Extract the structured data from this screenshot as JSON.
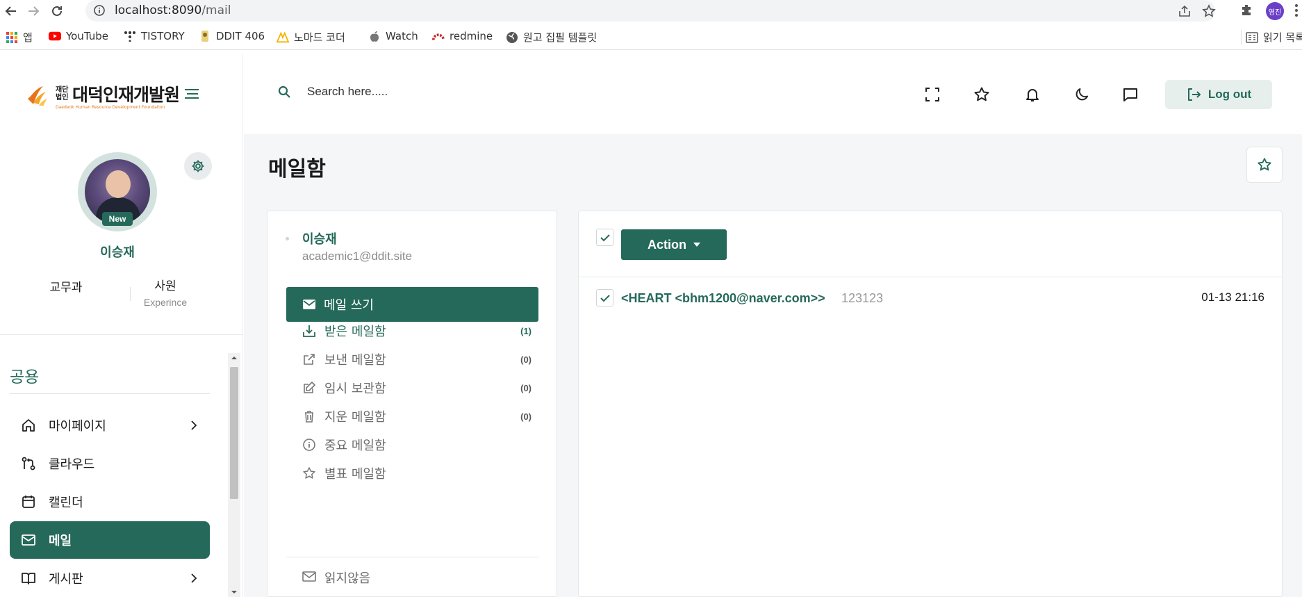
{
  "browser": {
    "url_host": "localhost:8090",
    "url_path": "/mail",
    "profile_initials": "영진",
    "reading_list": "읽기 목록",
    "bookmarks": [
      {
        "label": "앱",
        "icon": "apps-grid-icon"
      },
      {
        "label": "YouTube",
        "icon": "youtube-icon"
      },
      {
        "label": "TISTORY",
        "icon": "tistory-icon"
      },
      {
        "label": "DDIT 406",
        "icon": "ddit-icon"
      },
      {
        "label": "노마드 코더",
        "icon": "nomad-coders-icon"
      },
      {
        "label": "Watch",
        "icon": "apple-icon"
      },
      {
        "label": "redmine",
        "icon": "redmine-icon"
      },
      {
        "label": "원고 집필 템플릿",
        "icon": "globe-icon"
      }
    ]
  },
  "header": {
    "logo_main": "대덕인재개발원",
    "logo_prefix": "재단법인",
    "logo_sub": "Daedeok Human Resource Development Foundation",
    "search_placeholder": "Search here.....",
    "logout_label": "Log out"
  },
  "profile": {
    "name": "이승재",
    "badge": "New",
    "department": "교무과",
    "rank": "사원",
    "rank_sub": "Experince"
  },
  "sidebar": {
    "section": "공용",
    "items": [
      {
        "label": "마이페이지",
        "icon": "home-icon",
        "chevron": true,
        "active": false
      },
      {
        "label": "클라우드",
        "icon": "git-branch-icon",
        "chevron": false,
        "active": false
      },
      {
        "label": "캘린더",
        "icon": "calendar-icon",
        "chevron": false,
        "active": false
      },
      {
        "label": "메일",
        "icon": "mail-icon",
        "chevron": false,
        "active": true
      },
      {
        "label": "게시판",
        "icon": "book-icon",
        "chevron": true,
        "active": false
      }
    ]
  },
  "main": {
    "title": "메일함"
  },
  "mail_nav": {
    "name": "이승재",
    "email": "academic1@ddit.site",
    "compose_label": "메일 쓰기",
    "folders": [
      {
        "label": "받은 메일함",
        "count": "(1)",
        "icon": "inbox-download-icon"
      },
      {
        "label": "보낸 메일함",
        "count": "(0)",
        "icon": "external-link-icon"
      },
      {
        "label": "임시 보관함",
        "count": "(0)",
        "icon": "edit-icon"
      },
      {
        "label": "지운 메일함",
        "count": "(0)",
        "icon": "trash-icon"
      },
      {
        "label": "중요 메일함",
        "count": "",
        "icon": "info-icon"
      },
      {
        "label": "별표 메일함",
        "count": "",
        "icon": "star-icon"
      }
    ],
    "unread_label": "읽지않음"
  },
  "mail_list": {
    "action_label": "Action",
    "rows": [
      {
        "from": "<HEART <bhm1200@naver.com>>",
        "subject": "123123",
        "date": "01-13 21:16",
        "checked": true
      }
    ]
  },
  "colors": {
    "brand": "#25695a",
    "brand_light": "#e6efec",
    "page_bg": "#f4f6f8"
  }
}
